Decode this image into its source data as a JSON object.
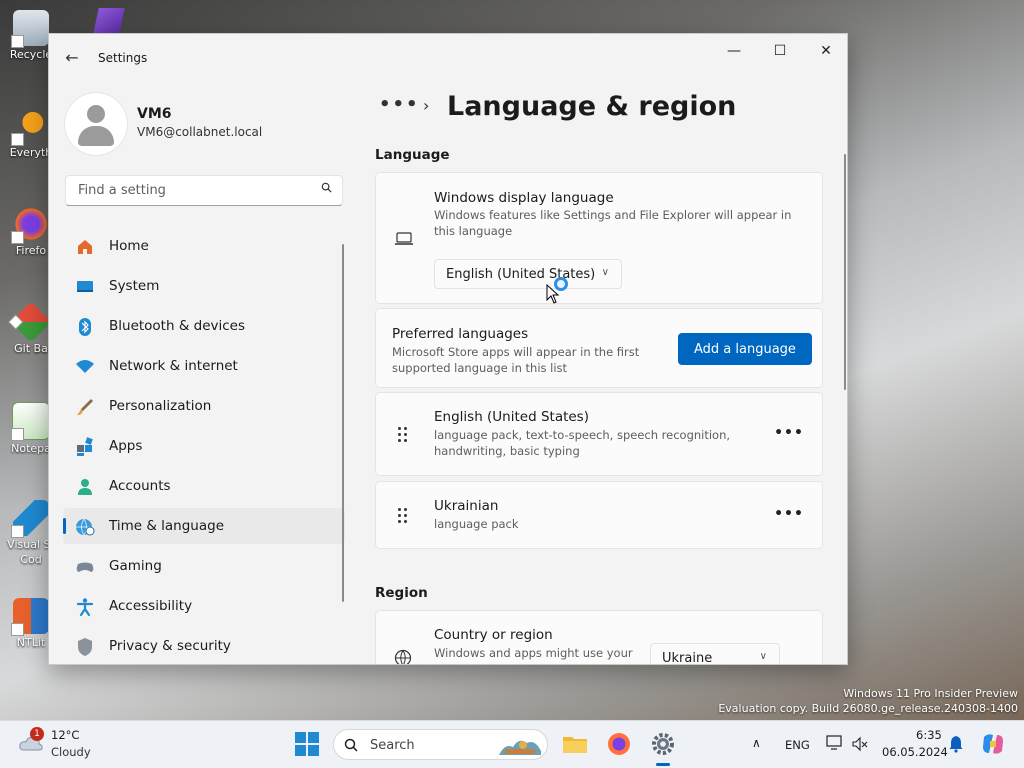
{
  "desktop": {
    "icons": [
      {
        "label": "Recycle"
      },
      {
        "label": "Everyth"
      },
      {
        "label": "Firefo"
      },
      {
        "label": "Git Ba"
      },
      {
        "label": "Notepa"
      },
      {
        "label": "Visual St"
      },
      {
        "label": "Cod"
      },
      {
        "label": "NTLit"
      }
    ],
    "watermark": {
      "line1": "Windows 11 Pro Insider Preview",
      "line2": "Evaluation copy. Build 26080.ge_release.240308-1400"
    }
  },
  "window": {
    "title": "Settings",
    "controls": {
      "minimize": "—",
      "maximize": "☐",
      "close": "✕"
    },
    "back_icon": "←"
  },
  "profile": {
    "name": "VM6",
    "email": "VM6@collabnet.local"
  },
  "search": {
    "placeholder": "Find a setting"
  },
  "nav": {
    "items": [
      {
        "label": "Home",
        "icon": "home-icon"
      },
      {
        "label": "System",
        "icon": "system-icon"
      },
      {
        "label": "Bluetooth & devices",
        "icon": "bluetooth-icon"
      },
      {
        "label": "Network & internet",
        "icon": "wifi-icon"
      },
      {
        "label": "Personalization",
        "icon": "brush-icon"
      },
      {
        "label": "Apps",
        "icon": "apps-icon"
      },
      {
        "label": "Accounts",
        "icon": "accounts-icon"
      },
      {
        "label": "Time & language",
        "icon": "globe-clock-icon",
        "active": true
      },
      {
        "label": "Gaming",
        "icon": "gamepad-icon"
      },
      {
        "label": "Accessibility",
        "icon": "accessibility-icon"
      },
      {
        "label": "Privacy & security",
        "icon": "shield-icon"
      }
    ]
  },
  "breadcrumb": {
    "more": "•••",
    "chevron": "›",
    "title": "Language & region"
  },
  "language_section": {
    "title": "Language",
    "display_language": {
      "title": "Windows display language",
      "description": "Windows features like Settings and File Explorer will appear in this language",
      "value": "English (United States)"
    },
    "preferred": {
      "title": "Preferred languages",
      "description": "Microsoft Store apps will appear in the first supported language in this list",
      "add_button": "Add a language"
    },
    "languages": [
      {
        "name": "English (United States)",
        "features": "language pack, text-to-speech, speech recognition, handwriting, basic typing"
      },
      {
        "name": "Ukrainian",
        "features": "language pack"
      }
    ],
    "more_label": "•••"
  },
  "region_section": {
    "title": "Region",
    "country": {
      "title": "Country or region",
      "description": "Windows and apps might use your",
      "value": "Ukraine"
    }
  },
  "taskbar": {
    "weather": {
      "temp": "12°C",
      "condition": "Cloudy",
      "badge": "1"
    },
    "search_placeholder": "Search",
    "language": "ENG",
    "time": "6:35",
    "date": "06.05.2024"
  },
  "colors": {
    "accent": "#0067c0",
    "window_bg": "#f3f3f3",
    "card_bg": "#fbfbfb"
  }
}
